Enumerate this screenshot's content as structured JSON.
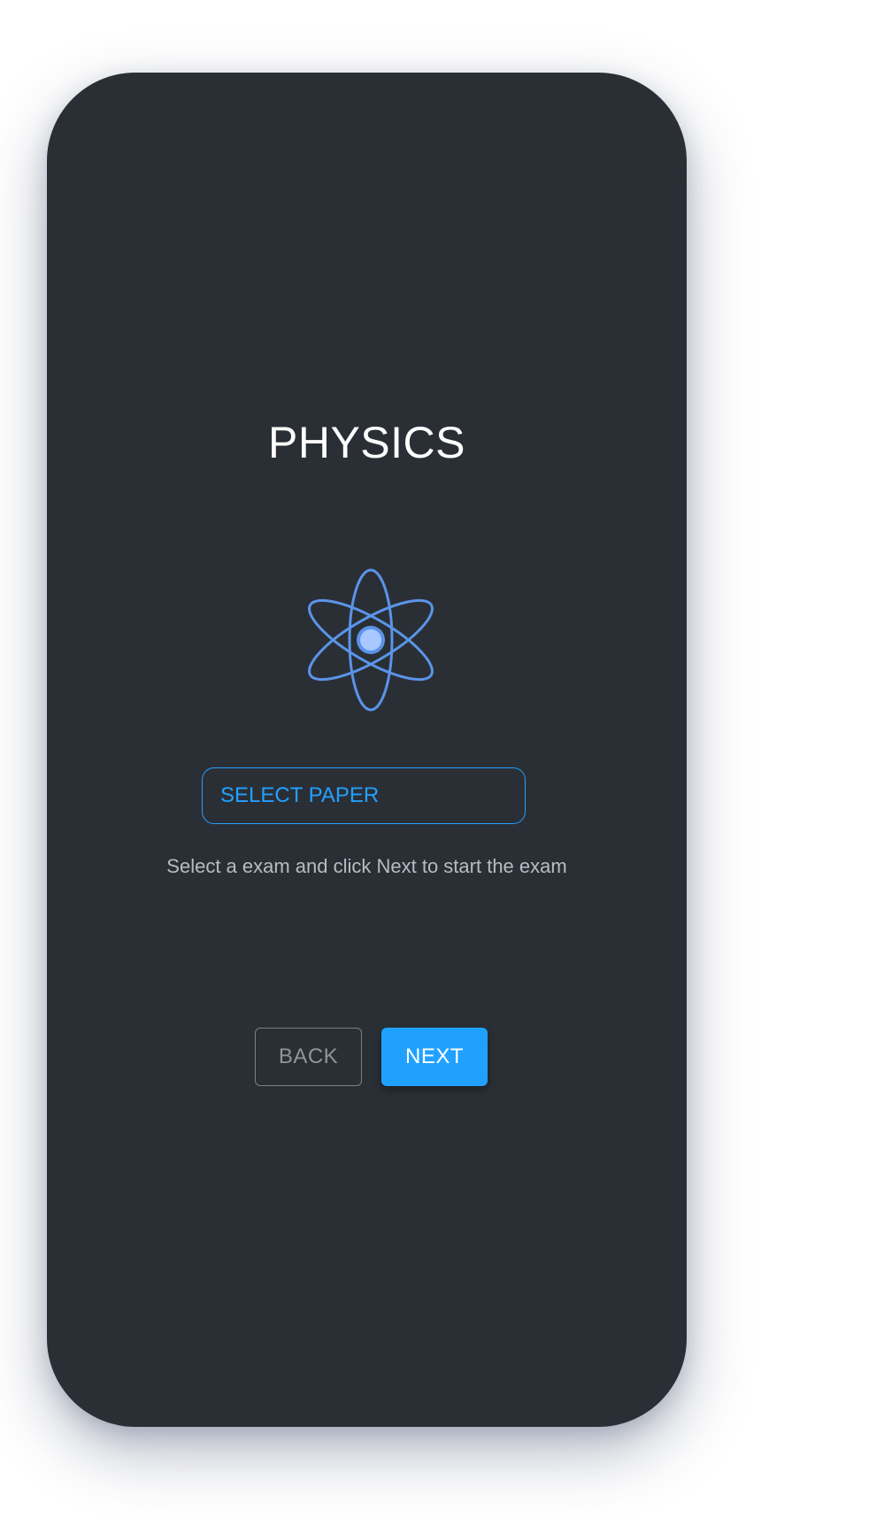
{
  "screen": {
    "title": "PHYSICS",
    "icon": "atom-icon",
    "select_paper_label": "SELECT PAPER",
    "hint": "Select a exam and click Next to start the exam",
    "back_label": "BACK",
    "next_label": "NEXT"
  },
  "colors": {
    "background": "#2a2f36",
    "accent": "#23a0ff",
    "title_text": "#ffffff",
    "hint_text": "#b7bcc2",
    "back_border": "#7b8087",
    "atom_orbit": "#5b94e8",
    "atom_nucleus": "#a8c8ff"
  }
}
